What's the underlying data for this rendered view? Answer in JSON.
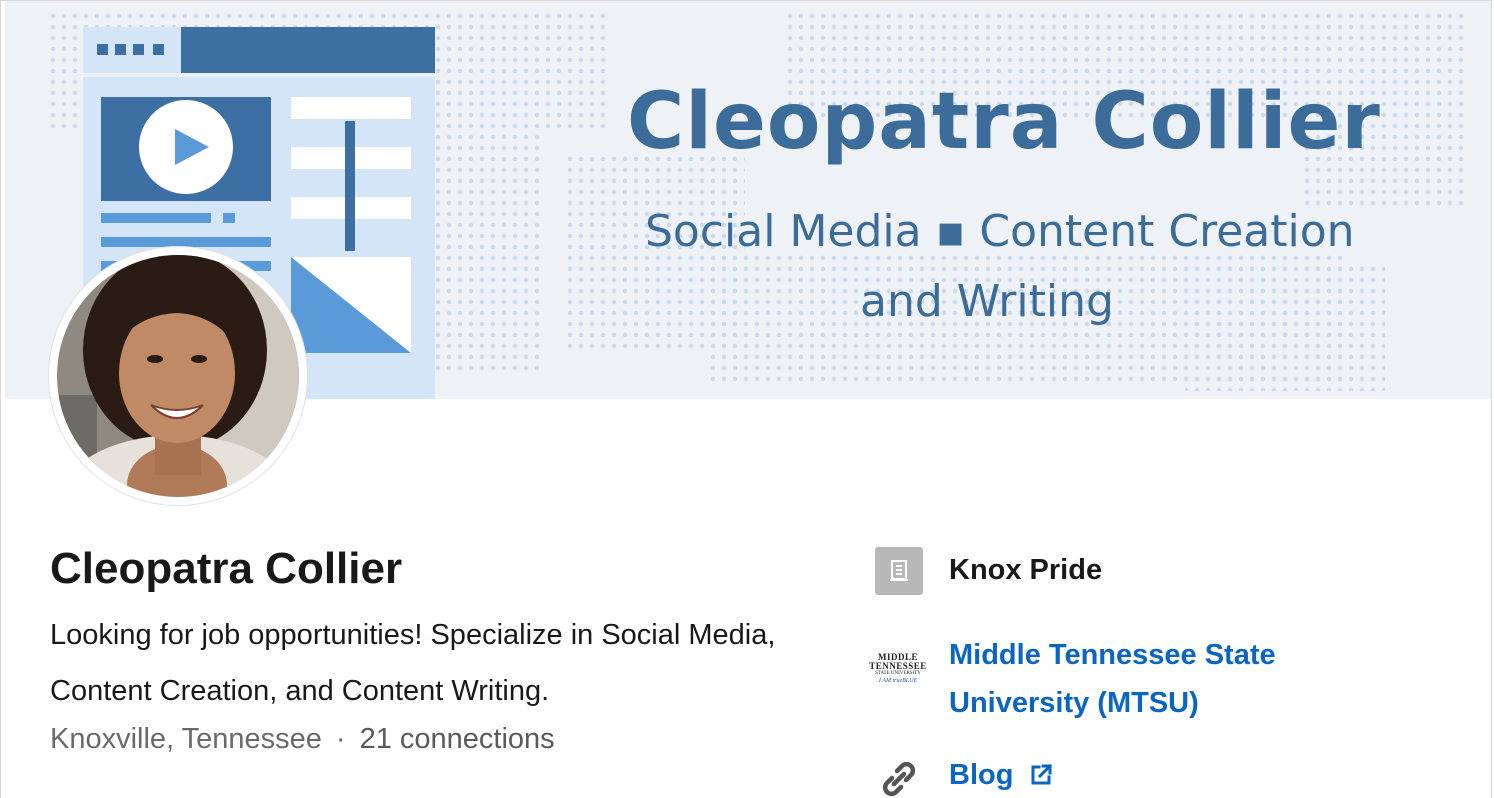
{
  "banner": {
    "title": "Cleopatra Collier",
    "subtitle_line1": "Social Media ▪ Content Creation",
    "subtitle_line2": "and Writing"
  },
  "profile": {
    "name": "Cleopatra Collier",
    "headline": "Looking for job opportunities! Specialize in Social Media, Content Creation, and Content Writing.",
    "location": "Knoxville, Tennessee",
    "separator": "·",
    "connections": "21 connections"
  },
  "sidebar": {
    "company": {
      "label": "Knox Pride",
      "icon": "building-icon"
    },
    "education": {
      "label": "Middle Tennessee State University (MTSU)",
      "logo_line1": "MIDDLE",
      "logo_line2": "TENNESSEE",
      "logo_line3": "STATE UNIVERSITY",
      "logo_line4": "I AM trueBLUE"
    },
    "website": {
      "label": "Blog",
      "icon": "link-icon",
      "external_icon": "external-link-icon"
    }
  },
  "colors": {
    "link": "#0a66c2",
    "banner_text": "#3b6c9a",
    "banner_bg": "#eef1f5",
    "muted_text": "#6a6a6a"
  }
}
